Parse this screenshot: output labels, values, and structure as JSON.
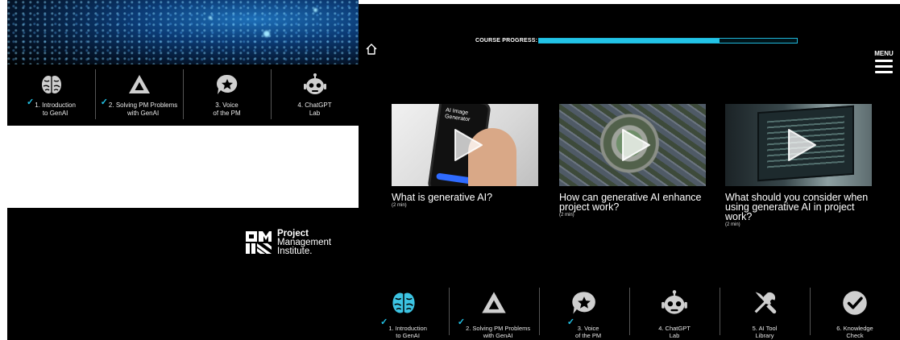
{
  "background_window": {
    "nav": [
      {
        "line1": "1. Introduction",
        "line2": "to GenAI",
        "completed": true,
        "icon": "brain-icon"
      },
      {
        "line1": "2. Solving PM Problems",
        "line2": "with GenAI",
        "completed": true,
        "icon": "triangle-logo-icon"
      },
      {
        "line1": "3. Voice",
        "line2": "of the PM",
        "completed": false,
        "icon": "speech-star-icon"
      },
      {
        "line1": "4. ChatGPT",
        "line2": "Lab",
        "completed": false,
        "icon": "robot-icon"
      }
    ],
    "logo": {
      "line1": "Project",
      "line2": "Management",
      "line3": "Institute."
    }
  },
  "main": {
    "progress_label": "COURSE PROGRESS:",
    "progress_fraction": 0.7,
    "menu_label": "MENU",
    "videos": [
      {
        "title": "What is generative AI?",
        "duration": "(2 min)",
        "thumb_text": "AI Image Generator"
      },
      {
        "title": "How can generative AI enhance project work?",
        "duration": "(2 min)"
      },
      {
        "title": "What should you consider when using generative AI in project work?",
        "duration": "(2 min)"
      }
    ],
    "nav": [
      {
        "line1": "1. Introduction",
        "line2": "to GenAI",
        "completed": true,
        "active": true,
        "icon": "brain-icon"
      },
      {
        "line1": "2. Solving PM Problems",
        "line2": "with GenAI",
        "completed": true,
        "active": false,
        "icon": "triangle-logo-icon"
      },
      {
        "line1": "3. Voice",
        "line2": "of the PM",
        "completed": true,
        "active": false,
        "icon": "speech-star-icon"
      },
      {
        "line1": "4. ChatGPT",
        "line2": "Lab",
        "completed": false,
        "active": false,
        "icon": "robot-icon"
      },
      {
        "line1": "5. AI Tool",
        "line2": "Library",
        "completed": false,
        "active": false,
        "icon": "tools-icon"
      },
      {
        "line1": "6. Knowledge",
        "line2": "Check",
        "completed": false,
        "active": false,
        "icon": "checkmark-circle-icon"
      }
    ]
  },
  "colors": {
    "accent": "#22c3e6",
    "icon_gray": "#cfcfcf",
    "background": "#000000"
  }
}
